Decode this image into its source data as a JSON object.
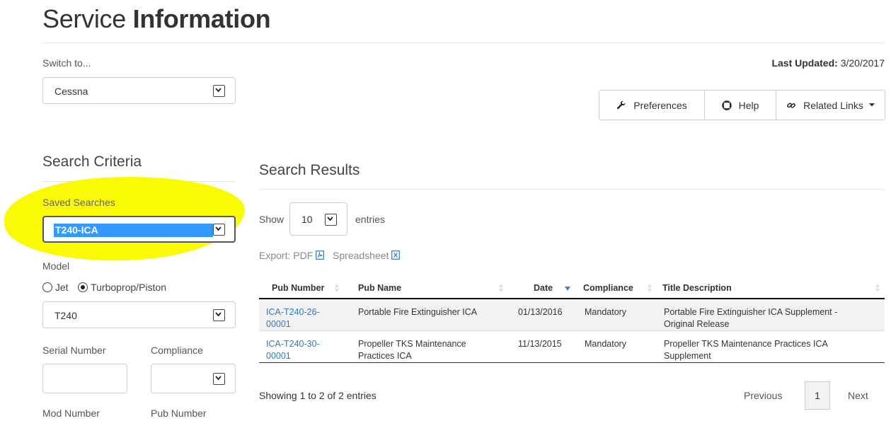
{
  "page": {
    "title_light": "Service",
    "title_bold": "Information"
  },
  "switch": {
    "label": "Switch to...",
    "value": "Cessna"
  },
  "last_updated": {
    "label": "Last Updated:",
    "value": "3/20/2017"
  },
  "toolbar": {
    "preferences": "Preferences",
    "help": "Help",
    "related_links": "Related Links"
  },
  "search_criteria": {
    "heading": "Search Criteria",
    "saved_searches_label": "Saved Searches",
    "saved_search_value": "T240-ICA",
    "model_label": "Model",
    "model_options": [
      "Jet",
      "Turboprop/Piston"
    ],
    "model_selected": "Turboprop/Piston",
    "model_value": "T240",
    "serial_number_label": "Serial Number",
    "compliance_label": "Compliance",
    "mod_number_label": "Mod Number",
    "pub_number_label": "Pub Number"
  },
  "results": {
    "heading": "Search Results",
    "show_label": "Show",
    "entries_value": "10",
    "entries_label": "entries",
    "export_label": "Export: PDF",
    "spreadsheet_label": "Spreadsheet",
    "columns": [
      "Pub Number",
      "Pub Name",
      "Date",
      "Compliance",
      "Title Description"
    ],
    "rows": [
      {
        "pub_number": "ICA-T240-26-00001",
        "pub_name": "Portable Fire Extinguisher ICA",
        "date": "01/13/2016",
        "compliance": "Mandatory",
        "title": "Portable Fire Extinguisher ICA Supplement - Original Release"
      },
      {
        "pub_number": "ICA-T240-30-00001",
        "pub_name": "Propeller TKS Maintenance Practices ICA",
        "date": "11/13/2015",
        "compliance": "Mandatory",
        "title": "Propeller TKS Maintenance Practices ICA Supplement"
      }
    ],
    "info": "Showing 1 to 2 of 2 entries",
    "pager": {
      "previous": "Previous",
      "current_page": "1",
      "next": "Next"
    }
  },
  "colors": {
    "highlight": "#fafa02",
    "link": "#337ab7",
    "selection": "#3399ff",
    "sort_active": "#4a7bd0"
  }
}
